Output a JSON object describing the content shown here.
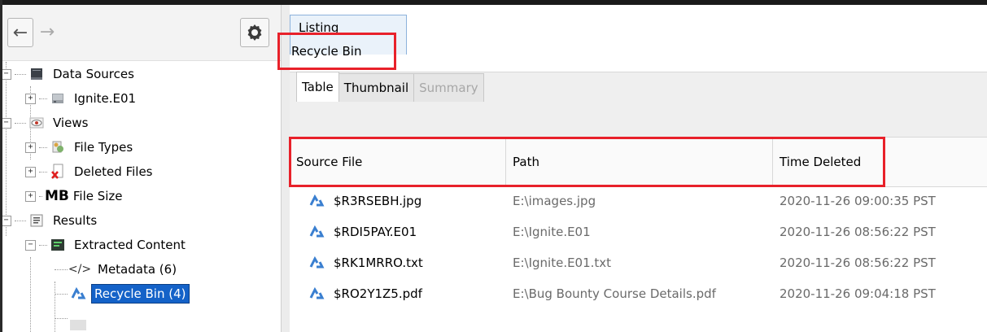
{
  "tree": {
    "items": [
      {
        "label": "Data Sources",
        "icon": "disk-stack-icon"
      },
      {
        "label": "Ignite.E01",
        "icon": "disk-image-icon"
      },
      {
        "label": "Views",
        "icon": "eye-icon"
      },
      {
        "label": "File Types",
        "icon": "file-types-icon"
      },
      {
        "label": "Deleted Files",
        "icon": "deleted-files-icon"
      },
      {
        "label": "File Size",
        "icon": "file-size-icon",
        "badge": "MB"
      },
      {
        "label": "Results",
        "icon": "results-icon"
      },
      {
        "label": "Extracted Content",
        "icon": "extracted-content-icon"
      },
      {
        "label": "Metadata (6)",
        "icon": "metadata-icon"
      },
      {
        "label": "Recycle Bin (4)",
        "icon": "recycle-bin-icon"
      }
    ]
  },
  "right": {
    "tab_label": "Listing",
    "title": "Recycle Bin",
    "subtabs": [
      "Table",
      "Thumbnail",
      "Summary"
    ]
  },
  "table": {
    "columns": [
      "Source File",
      "Path",
      "Time Deleted"
    ],
    "rows": [
      {
        "source": "$R3RSEBH.jpg",
        "path": "E:\\images.jpg",
        "time": "2020-11-26 09:00:35 PST"
      },
      {
        "source": "$RDI5PAY.E01",
        "path": "E:\\Ignite.E01",
        "time": "2020-11-26 08:56:22 PST"
      },
      {
        "source": "$RK1MRRO.txt",
        "path": "E:\\Ignite.E01.txt",
        "time": "2020-11-26 08:56:22 PST"
      },
      {
        "source": "$RO2Y1Z5.pdf",
        "path": "E:\\Bug Bounty Course Details.pdf",
        "time": "2020-11-26 09:04:18 PST"
      }
    ]
  },
  "colors": {
    "highlight": "#e8212a",
    "selection": "#1462c8",
    "recycle_icon": "#3a7fd0"
  }
}
